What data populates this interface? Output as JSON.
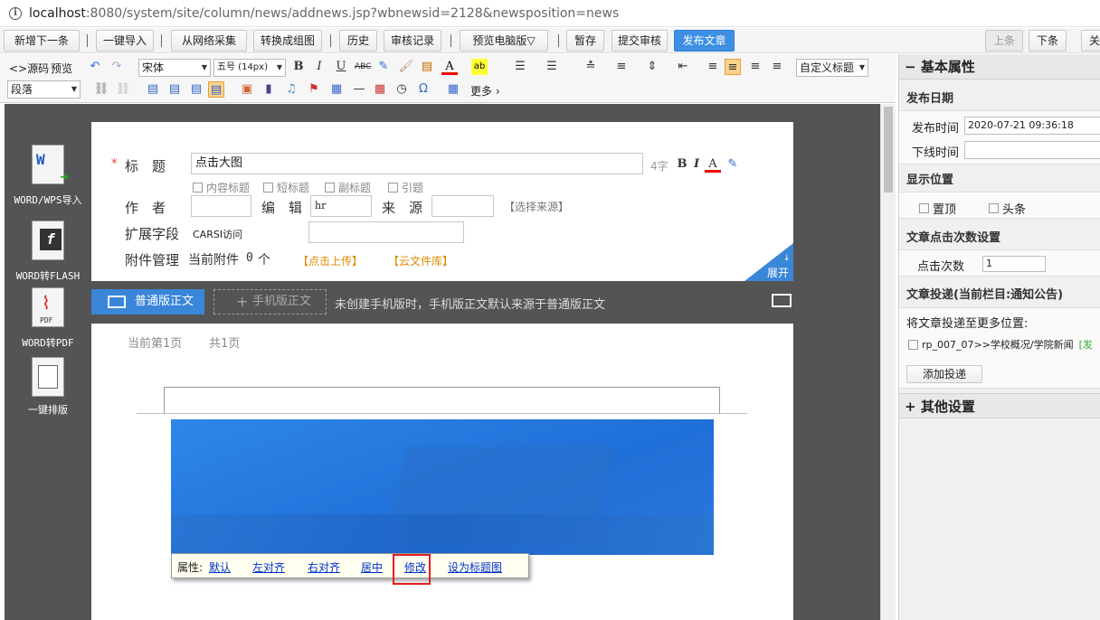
{
  "address": {
    "host": "localhost",
    "path": ":8080/system/site/column/news/addnews.jsp?wbnewsid=2128&newsposition=news"
  },
  "topbar": {
    "new_next": "新增下一条",
    "oneclick_import": "一键导入",
    "web_collect": "从网络采集",
    "to_group_image": "转换成组图",
    "history": "历史",
    "review_record": "审核记录",
    "preview_pc": "预览电脑版▽",
    "save_draft": "暂存",
    "submit_review": "提交审核",
    "publish": "发布文章",
    "prev": "上条",
    "next": "下条",
    "close": "关"
  },
  "editor": {
    "source": "源码",
    "preview": "预览",
    "font": "宋体",
    "size": "五号 (14px)",
    "paragraph": "段落",
    "custom_title": "自定义标题",
    "more": "更多"
  },
  "left_tools": {
    "word_import": "WORD/WPS导入",
    "word_flash": "WORD转FLASH",
    "word_pdf": "WORD转PDF",
    "format": "一键排版"
  },
  "form": {
    "required": "*",
    "title_label": "标　题",
    "title_value": "点击大图",
    "char_count": "4字",
    "opts": [
      "内容标题",
      "短标题",
      "副标题",
      "引题"
    ],
    "author_label": "作　者",
    "editor_label": "编　辑",
    "editor_value": "hr",
    "source_label": "来　源",
    "select_source": "【选择来源】",
    "ext_label": "扩展字段",
    "ext_value": "CARSI访问",
    "attach_label": "附件管理",
    "attach_current": "当前附件",
    "attach_count": "0",
    "attach_unit": "个",
    "upload": "【点击上传】",
    "cloud": "【云文件库】",
    "expand": "展开"
  },
  "tabs": {
    "normal": "普通版正文",
    "mobile": "手机版正文",
    "hint": "未创建手机版时，手机版正文默认来源于普通版正文"
  },
  "doc": {
    "page_current": "当前第1页",
    "page_total": "共1页"
  },
  "image_props": {
    "label": "属性:",
    "default": "默认",
    "left": "左对齐",
    "right": "右对齐",
    "center": "居中",
    "modify": "修改",
    "set_title": "设为标题图"
  },
  "right": {
    "basic": "基本属性",
    "publish_date": "发布日期",
    "publish_time_label": "发布时间",
    "publish_time": "2020-07-21 09:36:18",
    "offline_label": "下线时间",
    "display_pos": "显示位置",
    "top": "置顶",
    "headline": "头条",
    "click_settings": "文章点击次数设置",
    "click_label": "点击次数",
    "click_value": "1",
    "deliver_title": "文章投递(当前栏目:通知公告)",
    "deliver_more": "将文章投递至更多位置:",
    "deliver_item": "rp_007_07>>学校概况/学院新闻",
    "deliver_tag": "[发",
    "add_deliver": "添加投递",
    "other": "其他设置"
  }
}
